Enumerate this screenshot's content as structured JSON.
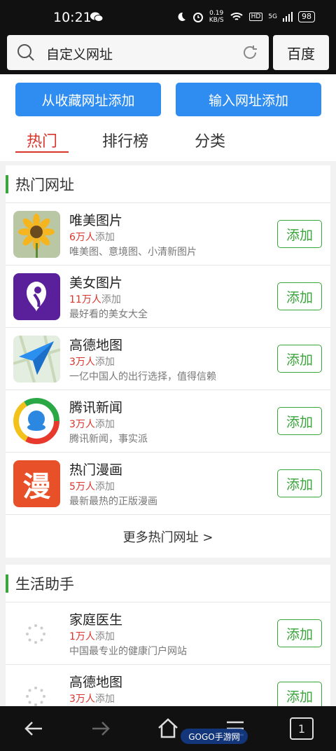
{
  "status": {
    "time": "10:21",
    "speed_value": "0.19",
    "speed_unit": "KB/S",
    "hd": "HD",
    "signal": "5G",
    "battery": "98"
  },
  "search": {
    "text": "自定义网址",
    "engine": "百度"
  },
  "buttons": {
    "from_favorites": "从收藏网址添加",
    "input_url": "输入网址添加"
  },
  "tabs": [
    "热门",
    "排行榜",
    "分类"
  ],
  "hot_section": {
    "title": "热门网址",
    "items": [
      {
        "name": "唯美图片",
        "count": "6万人",
        "count_suffix": "添加",
        "desc": "唯美图、意境图、小清新图片",
        "action": "添加",
        "icon": "sunflower-icon"
      },
      {
        "name": "美女图片",
        "count": "11万人",
        "count_suffix": "添加",
        "desc": "最好看的美女大全",
        "action": "添加",
        "icon": "girl-silhouette-icon"
      },
      {
        "name": "高德地图",
        "count": "3万人",
        "count_suffix": "添加",
        "desc": "一亿中国人的出行选择，值得信赖",
        "action": "添加",
        "icon": "paper-plane-map-icon"
      },
      {
        "name": "腾讯新闻",
        "count": "3万人",
        "count_suffix": "添加",
        "desc": "腾讯新闻，事实派",
        "action": "添加",
        "icon": "tencent-news-icon"
      },
      {
        "name": "热门漫画",
        "count": "5万人",
        "count_suffix": "添加",
        "desc": "最新最热的正版漫画",
        "action": "添加",
        "icon": "manga-icon",
        "icon_char": "漫"
      }
    ],
    "more": "更多热门网址 >"
  },
  "life_section": {
    "title": "生活助手",
    "items": [
      {
        "name": "家庭医生",
        "count": "1万人",
        "count_suffix": "添加",
        "desc": "中国最专业的健康门户网站",
        "action": "添加"
      },
      {
        "name": "高德地图",
        "count": "3万人",
        "count_suffix": "添加",
        "desc": "",
        "action": "添加"
      }
    ]
  },
  "navbar": {
    "tabs_count": "1",
    "watermark": "GOGO手游网"
  },
  "colors": {
    "accent_blue": "#2f8cf0",
    "accent_green": "#3aa53a",
    "accent_red": "#d9342b"
  }
}
